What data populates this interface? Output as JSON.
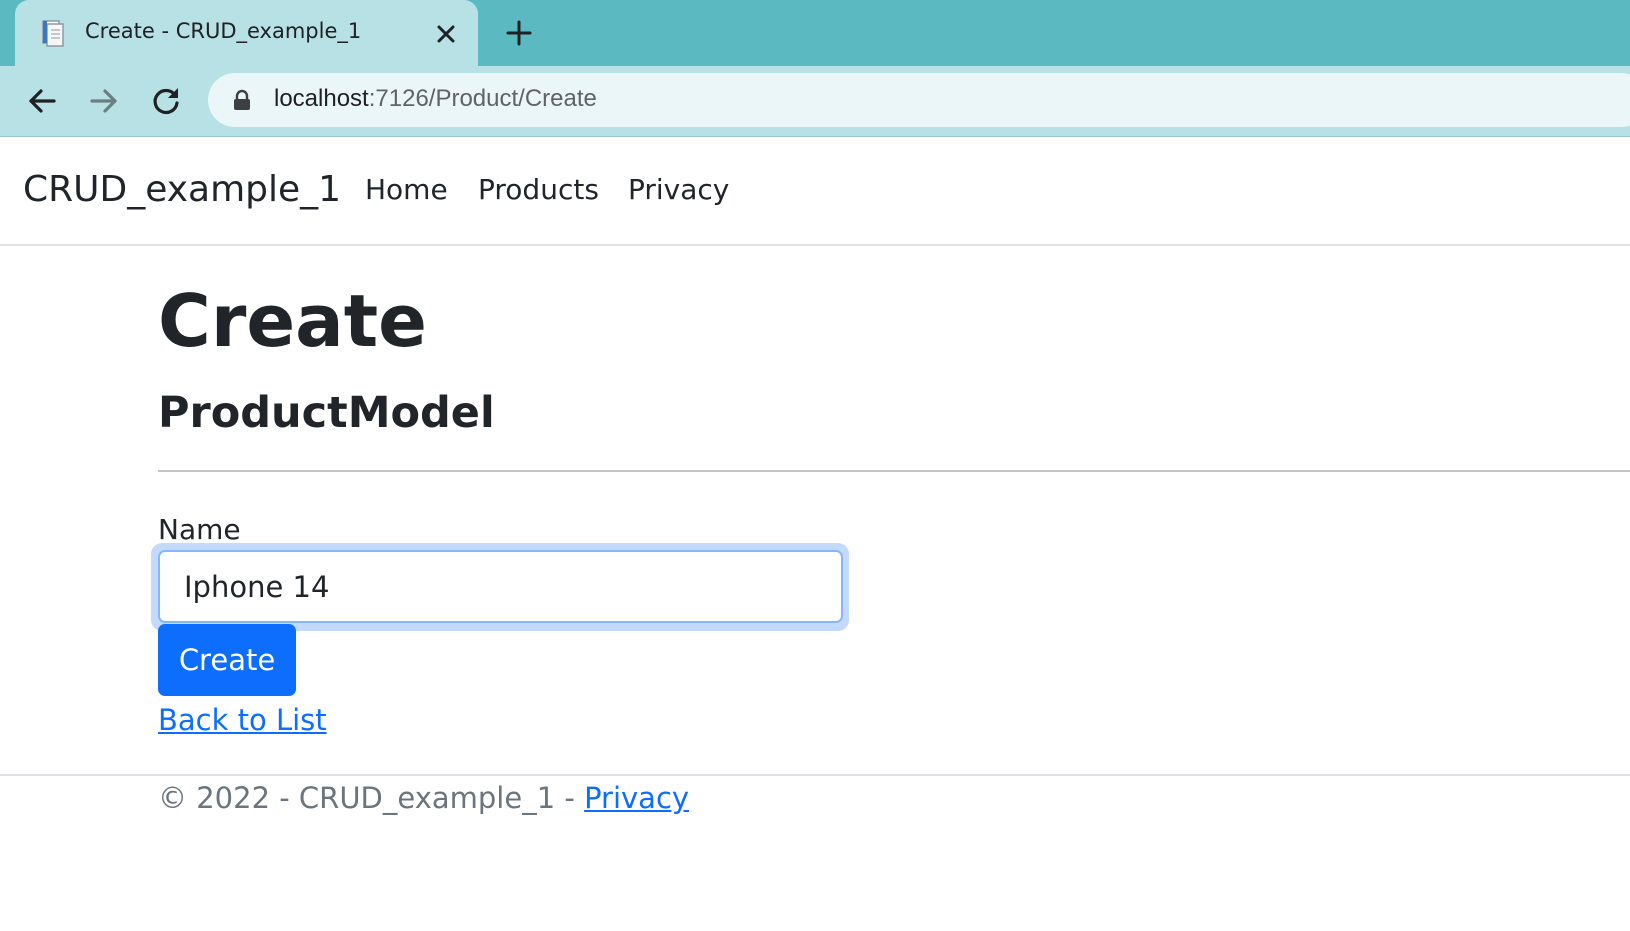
{
  "browser": {
    "tab": {
      "title": "Create - CRUD_example_1"
    },
    "address_bar": {
      "host": "localhost",
      "path": ":7126/Product/Create"
    },
    "icons": [
      "back-icon",
      "forward-icon",
      "reload-icon",
      "lock-icon",
      "close-icon",
      "plus-icon",
      "page-icon"
    ]
  },
  "navbar": {
    "brand": "CRUD_example_1",
    "links": [
      "Home",
      "Products",
      "Privacy"
    ]
  },
  "main": {
    "title": "Create",
    "subtitle": "ProductModel",
    "form": {
      "name_label": "Name",
      "name_value": "Iphone 14",
      "submit_label": "Create"
    },
    "back_link": "Back to List"
  },
  "footer": {
    "text": "© 2022 - CRUD_example_1 - ",
    "privacy_link": "Privacy"
  },
  "colors": {
    "tab_strip": "#5bb9c1",
    "toolbar": "#b7e1e5",
    "primary": "#0d6efd",
    "text": "#212529",
    "muted": "#6c757d"
  }
}
